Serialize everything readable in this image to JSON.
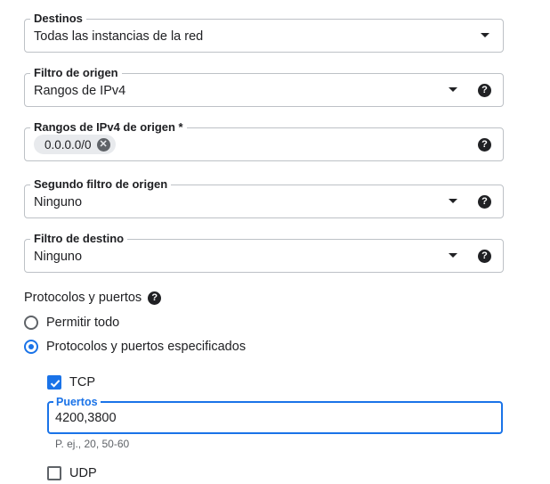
{
  "fields": {
    "destinos": {
      "label": "Destinos",
      "value": "Todas las instancias de la red"
    },
    "filtro_origen": {
      "label": "Filtro de origen",
      "value": "Rangos de IPv4"
    },
    "rangos_origen": {
      "label": "Rangos de IPv4 de origen *",
      "chip": "0.0.0.0/0"
    },
    "segundo_filtro": {
      "label": "Segundo filtro de origen",
      "value": "Ninguno"
    },
    "filtro_destino": {
      "label": "Filtro de destino",
      "value": "Ninguno"
    }
  },
  "help_glyph": "?",
  "chip_remove_glyph": "✕",
  "protocols": {
    "title": "Protocolos y puertos",
    "options": [
      {
        "label": "Permitir todo",
        "selected": false
      },
      {
        "label": "Protocolos y puertos especificados",
        "selected": true
      }
    ],
    "tcp": {
      "label": "TCP",
      "checked": true,
      "ports_label": "Puertos",
      "ports_value": "4200,3800",
      "hint": "P. ej., 20, 50-60"
    },
    "udp": {
      "label": "UDP",
      "checked": false
    }
  },
  "colors": {
    "accent": "#1a73e8",
    "border": "#bdc1c6",
    "text": "#202124",
    "muted": "#5f6368"
  }
}
